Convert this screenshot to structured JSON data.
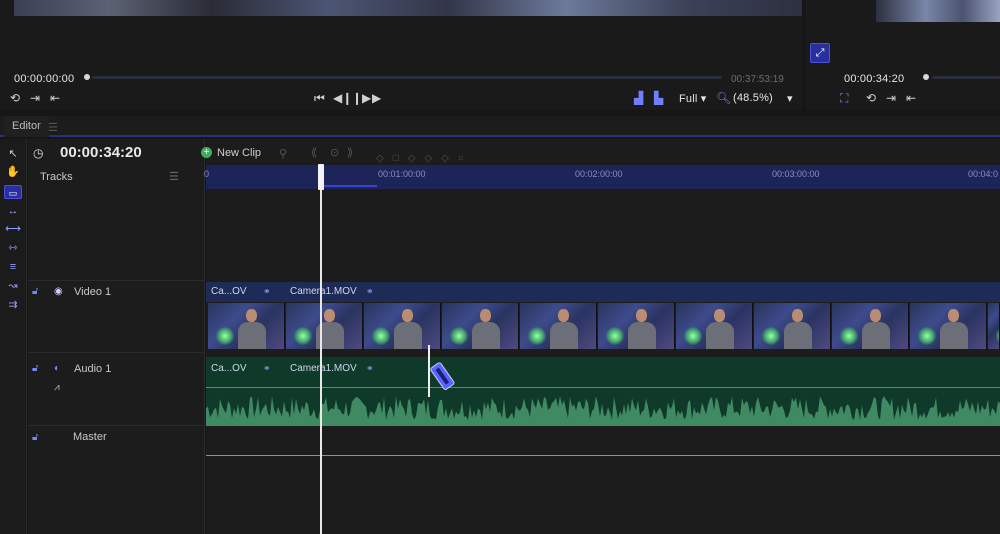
{
  "viewer": {
    "left_start_tc": "00:00:00:00",
    "left_end_tc": "00:37:53:19",
    "zoom_mode": "Full",
    "zoom_percent": "(48.5%)",
    "right_tc": "00:00:34:20"
  },
  "editor": {
    "tab_label": "Editor",
    "current_tc": "00:00:34:20",
    "new_clip_label": "New Clip",
    "tracks_label": "Tracks"
  },
  "ruler": {
    "labels": [
      "0",
      "00:01:00:00",
      "00:02:00:00",
      "00:03:00:00",
      "00:04:0"
    ]
  },
  "tracks": {
    "video": {
      "name": "Video 1",
      "clips": [
        "Ca...OV",
        "Camera1.MOV"
      ]
    },
    "audio": {
      "name": "Audio 1",
      "clips": [
        "Ca...OV",
        "Camera1.MOV"
      ]
    },
    "master": {
      "name": "Master"
    }
  },
  "colors": {
    "accent": "#4b52d8",
    "ruler_bg": "#1d2459",
    "video_track": "#1f2b57",
    "audio_track": "#0f3a2a",
    "waveform": "#3f8a62"
  },
  "icons": {
    "tools": [
      "pointer-icon",
      "hand-icon",
      "ripple-icon",
      "slip-icon",
      "slide-icon",
      "roll-icon",
      "track-select-icon",
      "curve-icon",
      "move-icon"
    ]
  }
}
